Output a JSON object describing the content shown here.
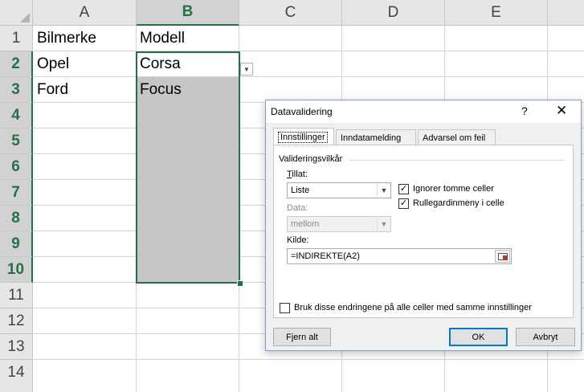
{
  "columns": [
    "A",
    "B",
    "C",
    "D",
    "E"
  ],
  "rows": [
    "1",
    "2",
    "3",
    "4",
    "5",
    "6",
    "7",
    "8",
    "9",
    "10",
    "11",
    "12",
    "13",
    "14"
  ],
  "cells": {
    "A1": "Bilmerke",
    "B1": "Modell",
    "A2": "Opel",
    "B2": "Corsa",
    "A3": "Ford",
    "B3": "Focus"
  },
  "colors": {
    "excel_green": "#217346",
    "selection_fill": "#c6c6c6",
    "header_bg": "#e6e6e6"
  },
  "cell_dropdown_icon": "chevron-down-icon",
  "dialog": {
    "title": "Datavalidering",
    "help": "?",
    "close": "✕",
    "tabs": [
      "Innstillinger",
      "Inndatamelding",
      "Advarsel om feil"
    ],
    "group_title": "Valideringsvilkår",
    "allow_label": "Tillat:",
    "allow_value": "Liste",
    "data_label": "Data:",
    "data_value": "mellom",
    "ignore_blank_label": "Ignorer tomme celler",
    "ignore_blank_checked": true,
    "incell_dropdown_label": "Rullegardinmeny i celle",
    "incell_dropdown_checked": true,
    "source_label": "Kilde:",
    "source_value": "=INDIREKTE(A2)",
    "apply_all_label": "Bruk disse endringene på alle celler med samme innstillinger",
    "apply_all_checked": false,
    "clear_all": "Fjern alt",
    "ok": "OK",
    "cancel": "Avbryt"
  }
}
